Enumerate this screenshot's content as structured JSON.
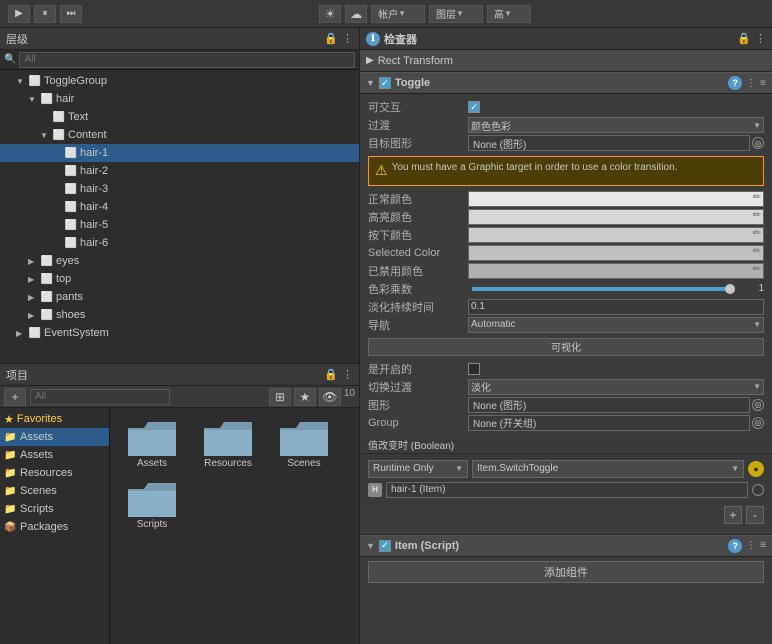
{
  "toolbar": {
    "play_label": "▶",
    "pause_label": "⏸",
    "step_label": "⏭",
    "center_icon1": "☀",
    "center_icon2": "☁",
    "account_label": "帐户",
    "layers_label": "图层",
    "high_label": "高"
  },
  "hierarchy": {
    "title": "层级",
    "search_placeholder": "All",
    "items": [
      {
        "label": "ToggleGroup",
        "indent": 1,
        "icon": "cube",
        "arrow": "▼"
      },
      {
        "label": "hair",
        "indent": 2,
        "icon": "cube",
        "arrow": "▼"
      },
      {
        "label": "Text",
        "indent": 3,
        "icon": "toggle",
        "arrow": ""
      },
      {
        "label": "Content",
        "indent": 3,
        "icon": "cube",
        "arrow": "▼"
      },
      {
        "label": "hair-1",
        "indent": 4,
        "icon": "cube",
        "arrow": ""
      },
      {
        "label": "hair-2",
        "indent": 4,
        "icon": "cube",
        "arrow": ""
      },
      {
        "label": "hair-3",
        "indent": 4,
        "icon": "cube",
        "arrow": ""
      },
      {
        "label": "hair-4",
        "indent": 4,
        "icon": "cube",
        "arrow": ""
      },
      {
        "label": "hair-5",
        "indent": 4,
        "icon": "cube",
        "arrow": ""
      },
      {
        "label": "hair-6",
        "indent": 4,
        "icon": "cube",
        "arrow": ""
      },
      {
        "label": "eyes",
        "indent": 2,
        "icon": "cube",
        "arrow": "▶"
      },
      {
        "label": "top",
        "indent": 2,
        "icon": "cube",
        "arrow": "▶"
      },
      {
        "label": "pants",
        "indent": 2,
        "icon": "cube",
        "arrow": "▶"
      },
      {
        "label": "shoes",
        "indent": 2,
        "icon": "cube",
        "arrow": "▶"
      },
      {
        "label": "EventSystem",
        "indent": 1,
        "icon": "cube",
        "arrow": "▶"
      }
    ]
  },
  "project": {
    "title": "项目",
    "sidebar": {
      "favorites_label": "Favorites",
      "items": [
        {
          "label": "Assets",
          "icon": "📁",
          "active": true
        },
        {
          "label": "Assets",
          "icon": "📁"
        },
        {
          "label": "Resources",
          "icon": "📁"
        },
        {
          "label": "Scenes",
          "icon": "📁"
        },
        {
          "label": "Scripts",
          "icon": "📁"
        },
        {
          "label": "Packages",
          "icon": "📦"
        }
      ]
    },
    "files": [
      {
        "label": "Assets",
        "type": "folder"
      },
      {
        "label": "Resources",
        "type": "folder"
      },
      {
        "label": "Scenes",
        "type": "folder"
      },
      {
        "label": "Scripts",
        "type": "folder"
      }
    ],
    "count": 10
  },
  "inspector": {
    "title": "检查器",
    "transform_label": "Rect Transform",
    "toggle": {
      "title": "Toggle",
      "interactable_label": "可交互",
      "interactable_checked": true,
      "transition_label": "过渡",
      "transition_value": "颜色色彩",
      "target_graphic_label": "目标图形",
      "target_graphic_value": "None (图形)",
      "warning_text": "You must have a Graphic target in order to use a color transition.",
      "normal_color_label": "正常颜色",
      "highlight_color_label": "高亮颜色",
      "pressed_color_label": "按下颜色",
      "selected_color_label": "Selected Color",
      "disabled_color_label": "已禁用颜色",
      "color_multiplier_label": "色彩乘数",
      "color_multiplier_value": "1",
      "fade_duration_label": "淡化持续时间",
      "fade_duration_value": "0.1",
      "navigation_label": "导航",
      "navigation_value": "Automatic",
      "visualize_label": "可视化",
      "is_on_label": "是开启的",
      "transition_toggle_label": "切换过渡",
      "transition_toggle_value": "淡化",
      "graphic_label": "图形",
      "graphic_value": "None (图形)",
      "group_label": "Group",
      "group_value": "None (开关组)",
      "on_value_changed_label": "值改变时 (Boolean)",
      "runtime_only_label": "Runtime Only",
      "func_name": "Item.SwitchToggle",
      "event_obj_label": "hair-1 (Item)",
      "add_label": "+",
      "remove_label": "-"
    },
    "item_script": {
      "title": "Item (Script)",
      "add_component_label": "添加组件"
    }
  }
}
